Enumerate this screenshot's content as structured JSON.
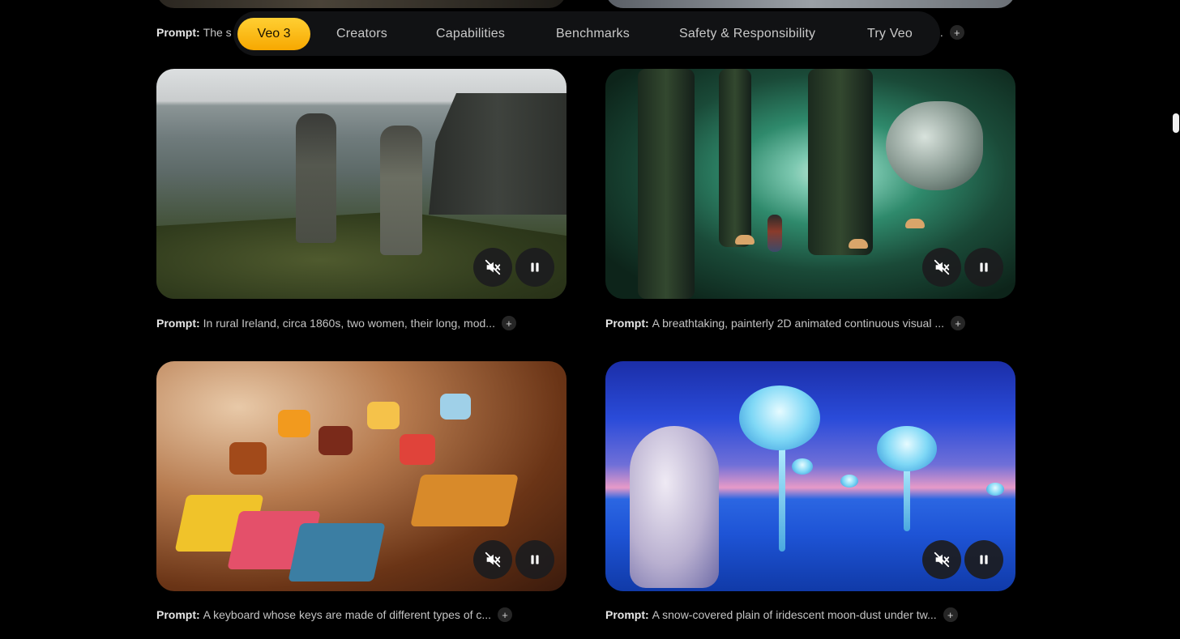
{
  "nav": {
    "items": [
      {
        "label": "Veo 3",
        "active": true
      },
      {
        "label": "Creators"
      },
      {
        "label": "Capabilities"
      },
      {
        "label": "Benchmarks"
      },
      {
        "label": "Safety & Responsibility"
      },
      {
        "label": "Try Veo"
      }
    ]
  },
  "top_row": {
    "prompt_left_prefix": "Prompt:",
    "prompt_left_text": "The s",
    "prompt_right_ellipsis": "..",
    "plus": "+"
  },
  "cards": [
    {
      "prompt_label": "Prompt:",
      "prompt_text": "In rural Ireland, circa 1860s, two women, their long, mod...",
      "plus": "+"
    },
    {
      "prompt_label": "Prompt:",
      "prompt_text": "A breathtaking, painterly 2D animated continuous visual ...",
      "plus": "+"
    },
    {
      "prompt_label": "Prompt:",
      "prompt_text": "A keyboard whose keys are made of different types of c...",
      "plus": "+"
    },
    {
      "prompt_label": "Prompt:",
      "prompt_text": "A snow-covered plain of iridescent moon-dust under tw...",
      "plus": "+"
    }
  ],
  "icons": {
    "mute": "volume-off-icon",
    "pause": "pause-icon",
    "expand": "plus-icon"
  },
  "colors": {
    "background": "#000000",
    "nav_active": "#f7a800",
    "control_bg": "#1c1c1e"
  }
}
